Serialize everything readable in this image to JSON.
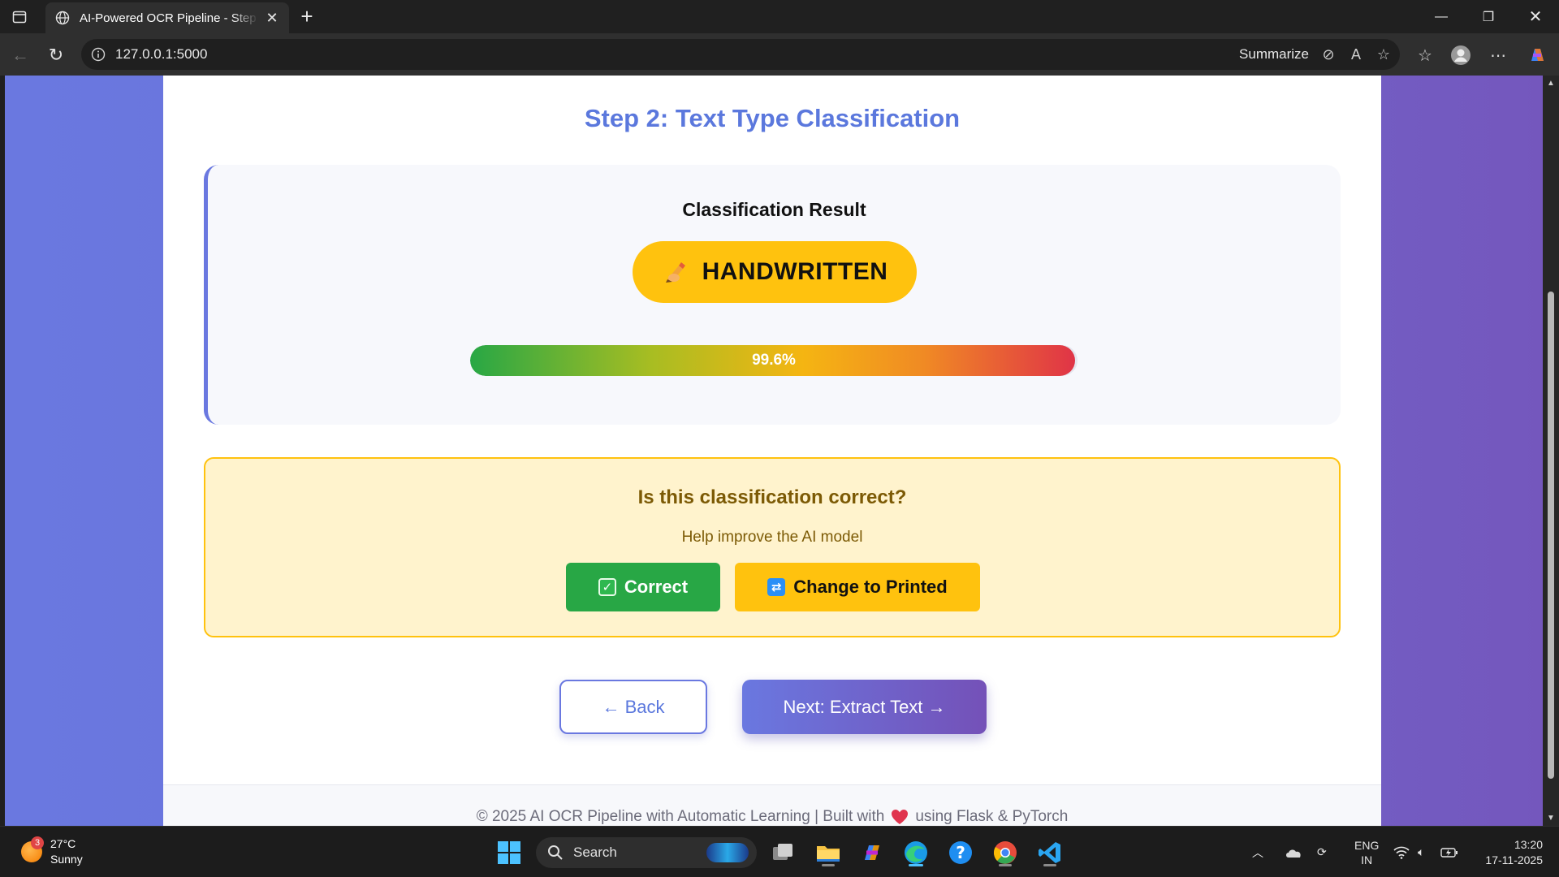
{
  "browser": {
    "tab_title": "AI-Powered OCR Pipeline - Step b",
    "url": "127.0.0.1:5000",
    "summarize_label": "Summarize"
  },
  "page": {
    "step_title": "Step 2: Text Type Classification",
    "result": {
      "heading": "Classification Result",
      "label": "HANDWRITTEN",
      "confidence_text": "99.6%",
      "confidence_value": 99.6
    },
    "feedback": {
      "heading": "Is this classification correct?",
      "subtext": "Help improve the AI model",
      "correct_label": "Correct",
      "change_label": "Change to Printed"
    },
    "nav": {
      "back_label": "← Back",
      "next_label": "Next: Extract Text →"
    },
    "footer": {
      "text_before": "© 2025 AI OCR Pipeline with Automatic Learning | Built with",
      "text_after": "using Flask & PyTorch"
    }
  },
  "taskbar": {
    "weather_temp": "27°C",
    "weather_desc": "Sunny",
    "weather_badge": "3",
    "search_placeholder": "Search",
    "lang_line1": "ENG",
    "lang_line2": "IN",
    "time": "13:20",
    "date": "17-11-2025"
  },
  "colors": {
    "accent": "#5b78dd",
    "badge_yellow": "#ffc20e",
    "success_green": "#28a745",
    "feedback_bg": "#fff3cd"
  }
}
